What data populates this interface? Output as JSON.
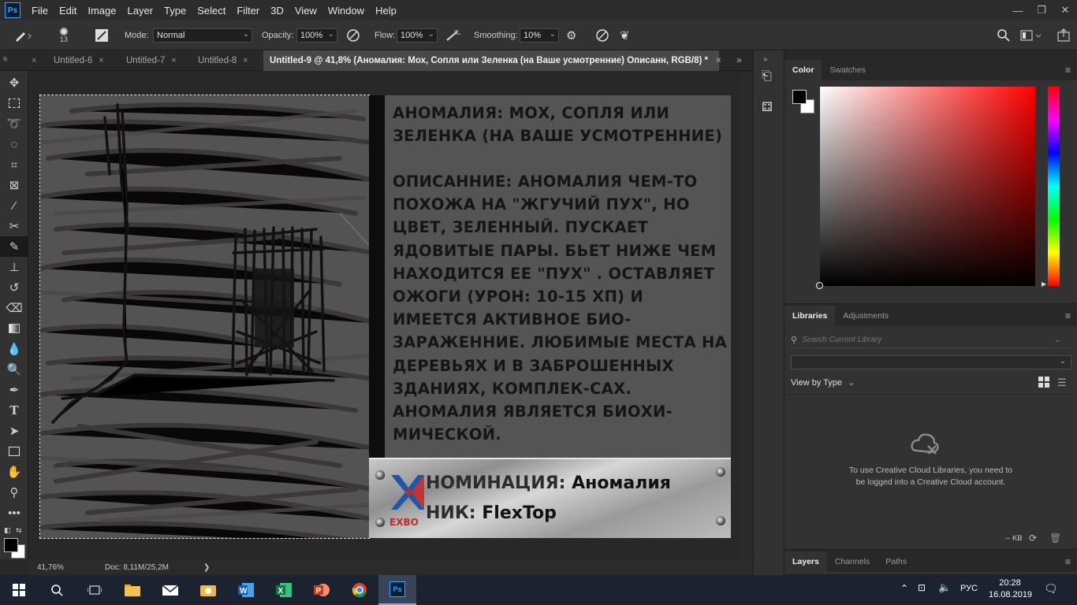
{
  "app": {
    "logo": "Ps"
  },
  "menu": [
    "File",
    "Edit",
    "Image",
    "Layer",
    "Type",
    "Select",
    "Filter",
    "3D",
    "View",
    "Window",
    "Help"
  ],
  "options": {
    "brush_size": "13",
    "mode_label": "Mode:",
    "mode_value": "Normal",
    "opacity_label": "Opacity:",
    "opacity_value": "100%",
    "flow_label": "Flow:",
    "flow_value": "100%",
    "smoothing_label": "Smoothing:",
    "smoothing_value": "10%"
  },
  "tabs": [
    {
      "label": "Untitled-6",
      "close": "×"
    },
    {
      "label": "Untitled-7",
      "close": "×"
    },
    {
      "label": "Untitled-8",
      "close": "×"
    },
    {
      "label": "Untitled-9 @ 41,8% (Аномалия: Мох, Сопля или Зеленка (на Ваше усмотренние)  Описанн, RGB/8) *",
      "close": "×"
    }
  ],
  "document": {
    "title": "Аномалия: Мох, сопля или зеленка (на Ваше усмотренние)",
    "description": "Описанние: Аномалия чем-то похожа на \"жгучий пух\", но цвет, зеленный. Пускает ядовитые пары. Бьет ниже чем находится ее \"пух\" . Оставляет ожоги (урон: 10-15 хп) и имеется активное био-зараженние. Любимые места на деревьях и в заброшенных зданиях, комплек-сах. Аномалия является биохи-мической.",
    "nomination_key": "Номинация:",
    "nomination_value": "Аномалия",
    "nick_key": "Ник:",
    "nick_value": "FlexTop",
    "logo_text": "EXBO"
  },
  "status": {
    "zoom": "41,76%",
    "doc": "Doc: 8,11M/25,2M",
    "arrow": "❯"
  },
  "color_panel": {
    "tab1": "Color",
    "tab2": "Swatches",
    "menu": "≡"
  },
  "libraries_panel": {
    "tab1": "Libraries",
    "tab2": "Adjustments",
    "menu": "≡",
    "search_placeholder": "Search Current Library",
    "view_by": "View by Type",
    "message": "To use Creative Cloud Libraries, you need to be logged into a Creative Cloud account.",
    "size_label": "-- KB"
  },
  "layers_panel": {
    "tab1": "Layers",
    "tab2": "Channels",
    "tab3": "Paths",
    "menu": "≡"
  },
  "taskbar": {
    "lang": "РУС",
    "time": "20:28",
    "date": "16.08.2019"
  }
}
